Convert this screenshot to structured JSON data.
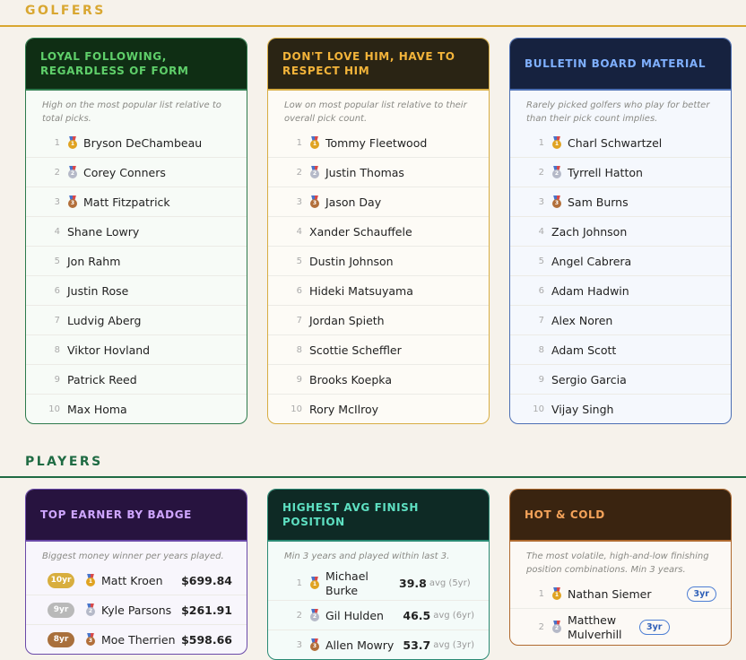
{
  "sections": {
    "golfers": "GOLFERS",
    "players": "PLAYERS"
  },
  "colors": {
    "golfers_accent": "#d9a731",
    "players_accent": "#1f6b43"
  },
  "golfer_cards": [
    {
      "title": "LOYAL FOLLOWING, REGARDLESS OF FORM",
      "description": "High on the most popular list relative to total picks.",
      "rows": [
        {
          "rank": "1",
          "name": "Bryson DeChambeau",
          "medal": "gold-medal-icon"
        },
        {
          "rank": "2",
          "name": "Corey Conners",
          "medal": "silver-medal-icon"
        },
        {
          "rank": "3",
          "name": "Matt Fitzpatrick",
          "medal": "bronze-medal-icon"
        },
        {
          "rank": "4",
          "name": "Shane Lowry"
        },
        {
          "rank": "5",
          "name": "Jon Rahm"
        },
        {
          "rank": "6",
          "name": "Justin Rose"
        },
        {
          "rank": "7",
          "name": "Ludvig Aberg"
        },
        {
          "rank": "8",
          "name": "Viktor Hovland"
        },
        {
          "rank": "9",
          "name": "Patrick Reed"
        },
        {
          "rank": "10",
          "name": "Max Homa"
        }
      ]
    },
    {
      "title": "DON'T LOVE HIM, HAVE TO RESPECT HIM",
      "description": "Low on most popular list relative to their overall pick count.",
      "rows": [
        {
          "rank": "1",
          "name": "Tommy Fleetwood",
          "medal": "gold-medal-icon"
        },
        {
          "rank": "2",
          "name": "Justin Thomas",
          "medal": "silver-medal-icon"
        },
        {
          "rank": "3",
          "name": "Jason Day",
          "medal": "bronze-medal-icon"
        },
        {
          "rank": "4",
          "name": "Xander Schauffele"
        },
        {
          "rank": "5",
          "name": "Dustin Johnson"
        },
        {
          "rank": "6",
          "name": "Hideki Matsuyama"
        },
        {
          "rank": "7",
          "name": "Jordan Spieth"
        },
        {
          "rank": "8",
          "name": "Scottie Scheffler"
        },
        {
          "rank": "9",
          "name": "Brooks Koepka"
        },
        {
          "rank": "10",
          "name": "Rory McIlroy"
        }
      ]
    },
    {
      "title": "BULLETIN BOARD MATERIAL",
      "description": "Rarely picked golfers who play for better than their pick count implies.",
      "rows": [
        {
          "rank": "1",
          "name": "Charl Schwartzel",
          "medal": "gold-medal-icon"
        },
        {
          "rank": "2",
          "name": "Tyrrell Hatton",
          "medal": "silver-medal-icon"
        },
        {
          "rank": "3",
          "name": "Sam Burns",
          "medal": "bronze-medal-icon"
        },
        {
          "rank": "4",
          "name": "Zach Johnson"
        },
        {
          "rank": "5",
          "name": "Angel Cabrera"
        },
        {
          "rank": "6",
          "name": "Adam Hadwin"
        },
        {
          "rank": "7",
          "name": "Alex Noren"
        },
        {
          "rank": "8",
          "name": "Adam Scott"
        },
        {
          "rank": "9",
          "name": "Sergio Garcia"
        },
        {
          "rank": "10",
          "name": "Vijay Singh"
        }
      ]
    }
  ],
  "player_cards": [
    {
      "title": "TOP EARNER BY BADGE",
      "description": "Biggest money winner per years played.",
      "rows": [
        {
          "years": "10yr",
          "name": "Matt Kroen",
          "amount": "$699.84",
          "medal": "gold-medal-icon"
        },
        {
          "years": "9yr",
          "name": "Kyle Parsons",
          "amount": "$261.91",
          "medal": "silver-medal-icon"
        },
        {
          "years": "8yr",
          "name": "Moe Therrien",
          "amount": "$598.66",
          "medal": "bronze-medal-icon"
        }
      ]
    },
    {
      "title": "HIGHEST AVG FINISH POSITION",
      "description": "Min 3 years and played within last 3.",
      "rows": [
        {
          "rank": "1",
          "name": "Michael Burke",
          "avg": "39.8",
          "avg_label": "avg (5yr)",
          "medal": "gold-medal-icon"
        },
        {
          "rank": "2",
          "name": "Gil Hulden",
          "avg": "46.5",
          "avg_label": "avg (6yr)",
          "medal": "silver-medal-icon"
        },
        {
          "rank": "3",
          "name": "Allen Mowry",
          "avg": "53.7",
          "avg_label": "avg (3yr)",
          "medal": "bronze-medal-icon"
        }
      ]
    },
    {
      "title": "HOT & COLD",
      "description": "The most volatile, high-and-low finishing position combinations. Min 3 years.",
      "rows": [
        {
          "rank": "1",
          "name": "Nathan Siemer",
          "pill": "3yr",
          "medal": "gold-medal-icon"
        },
        {
          "rank": "2",
          "name": "Matthew Mulverhill",
          "pill": "3yr",
          "medal": "silver-medal-icon"
        }
      ]
    }
  ]
}
